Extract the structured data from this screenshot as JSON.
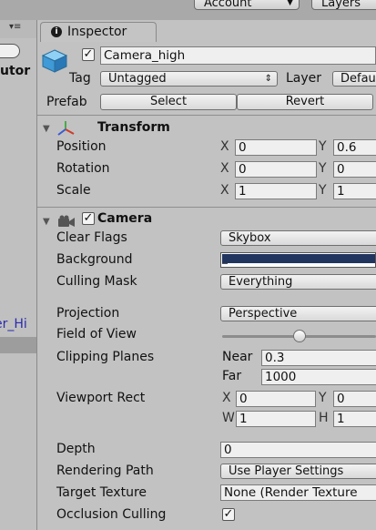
{
  "toolbar": {
    "account_label": "Account",
    "layers_label": "Layers"
  },
  "hierarchy": {
    "menu_icon": "▾≡",
    "label": "utor",
    "item": "er_Hi"
  },
  "inspector": {
    "tab_title": "Inspector",
    "tab_icon": "i",
    "object": {
      "name": "Camera_high",
      "tag_label": "Tag",
      "tag_value": "Untagged",
      "layer_label": "Layer",
      "layer_value": "Defau",
      "prefab_label": "Prefab",
      "select_label": "Select",
      "revert_label": "Revert"
    },
    "transform": {
      "title": "Transform",
      "position_label": "Position",
      "position": {
        "x": "0",
        "y": "0.6"
      },
      "rotation_label": "Rotation",
      "rotation": {
        "x": "0",
        "y": "0"
      },
      "scale_label": "Scale",
      "scale": {
        "x": "1",
        "y": "1"
      }
    },
    "camera": {
      "title": "Camera",
      "clear_flags_label": "Clear Flags",
      "clear_flags": "Skybox",
      "background_label": "Background",
      "background_color": "#22355f",
      "culling_mask_label": "Culling Mask",
      "culling_mask": "Everything",
      "projection_label": "Projection",
      "projection": "Perspective",
      "fov_label": "Field of View",
      "fov_slider_fraction": 0.5,
      "clipping_label": "Clipping Planes",
      "near_label": "Near",
      "near": "0.3",
      "far_label": "Far",
      "far": "1000",
      "viewport_label": "Viewport Rect",
      "viewport": {
        "x": "0",
        "y": "0",
        "w": "1",
        "h": "1"
      },
      "depth_label": "Depth",
      "depth": "0",
      "rendering_path_label": "Rendering Path",
      "rendering_path": "Use Player Settings",
      "target_texture_label": "Target Texture",
      "target_texture": "None (Render Texture",
      "occlusion_label": "Occlusion Culling"
    },
    "axes": {
      "x": "X",
      "y": "Y",
      "w": "W",
      "h": "H"
    },
    "check_mark": "✓"
  },
  "colors": {
    "panel": "#c2c2c2",
    "field": "#efefef",
    "background_swatch": "#22355f"
  }
}
